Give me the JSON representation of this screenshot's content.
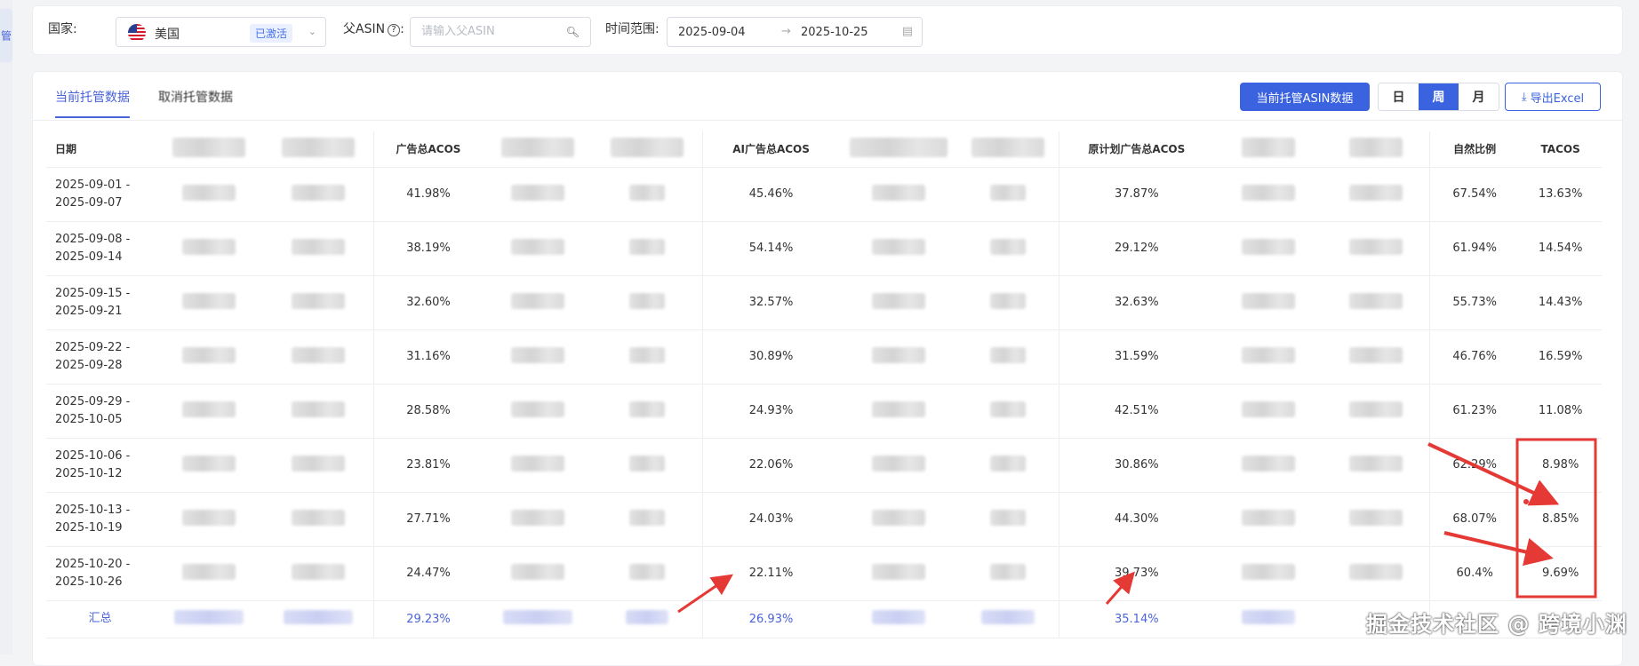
{
  "sidebar": {
    "tab_label": "管"
  },
  "filters": {
    "country_label": "国家:",
    "country_value": "美国",
    "country_status": "已激活",
    "parent_asin_label": "父ASIN",
    "parent_asin_placeholder": "请输入父ASIN",
    "date_label": "时间范围:",
    "date_start": "2025-09-04",
    "date_end": "2025-10-25"
  },
  "toolbar": {
    "tab_current": "当前托管数据",
    "tab_cancelled": "取消托管数据",
    "asin_button": "当前托管ASIN数据",
    "period_day": "日",
    "period_week": "周",
    "period_month": "月",
    "period_selected": "周",
    "export_label": "导出Excel"
  },
  "table": {
    "headers": {
      "date": "日期",
      "ad_acos": "广告总ACOS",
      "ai_acos": "AI广告总ACOS",
      "orig_acos": "原计划广告总ACOS",
      "natural_ratio": "自然比例",
      "tacos": "TACOS"
    },
    "rows": [
      {
        "date": "2025-09-01 - 2025-09-07",
        "ad_acos": "41.98%",
        "ai_acos": "45.46%",
        "orig_acos": "37.87%",
        "natural_ratio": "67.54%",
        "tacos": "13.63%"
      },
      {
        "date": "2025-09-08 - 2025-09-14",
        "ad_acos": "38.19%",
        "ai_acos": "54.14%",
        "orig_acos": "29.12%",
        "natural_ratio": "61.94%",
        "tacos": "14.54%"
      },
      {
        "date": "2025-09-15 - 2025-09-21",
        "ad_acos": "32.60%",
        "ai_acos": "32.57%",
        "orig_acos": "32.63%",
        "natural_ratio": "55.73%",
        "tacos": "14.43%"
      },
      {
        "date": "2025-09-22 - 2025-09-28",
        "ad_acos": "31.16%",
        "ai_acos": "30.89%",
        "orig_acos": "31.59%",
        "natural_ratio": "46.76%",
        "tacos": "16.59%"
      },
      {
        "date": "2025-09-29 - 2025-10-05",
        "ad_acos": "28.58%",
        "ai_acos": "24.93%",
        "orig_acos": "42.51%",
        "natural_ratio": "61.23%",
        "tacos": "11.08%"
      },
      {
        "date": "2025-10-06 - 2025-10-12",
        "ad_acos": "23.81%",
        "ai_acos": "22.06%",
        "orig_acos": "30.86%",
        "natural_ratio": "62.29%",
        "tacos": "8.98%"
      },
      {
        "date": "2025-10-13 - 2025-10-19",
        "ad_acos": "27.71%",
        "ai_acos": "24.03%",
        "orig_acos": "44.30%",
        "natural_ratio": "68.07%",
        "tacos": "8.85%"
      },
      {
        "date": "2025-10-20 - 2025-10-26",
        "ad_acos": "24.47%",
        "ai_acos": "22.11%",
        "orig_acos": "39.73%",
        "natural_ratio": "60.4%",
        "tacos": "9.69%"
      }
    ],
    "total": {
      "date": "汇总",
      "ad_acos": "29.23%",
      "ai_acos": "26.93%",
      "orig_acos": "35.14%"
    }
  },
  "watermark": "掘金技术社区 @ 跨境小渊",
  "colors": {
    "accent": "#3b63e0",
    "annotation": "#e53935"
  }
}
